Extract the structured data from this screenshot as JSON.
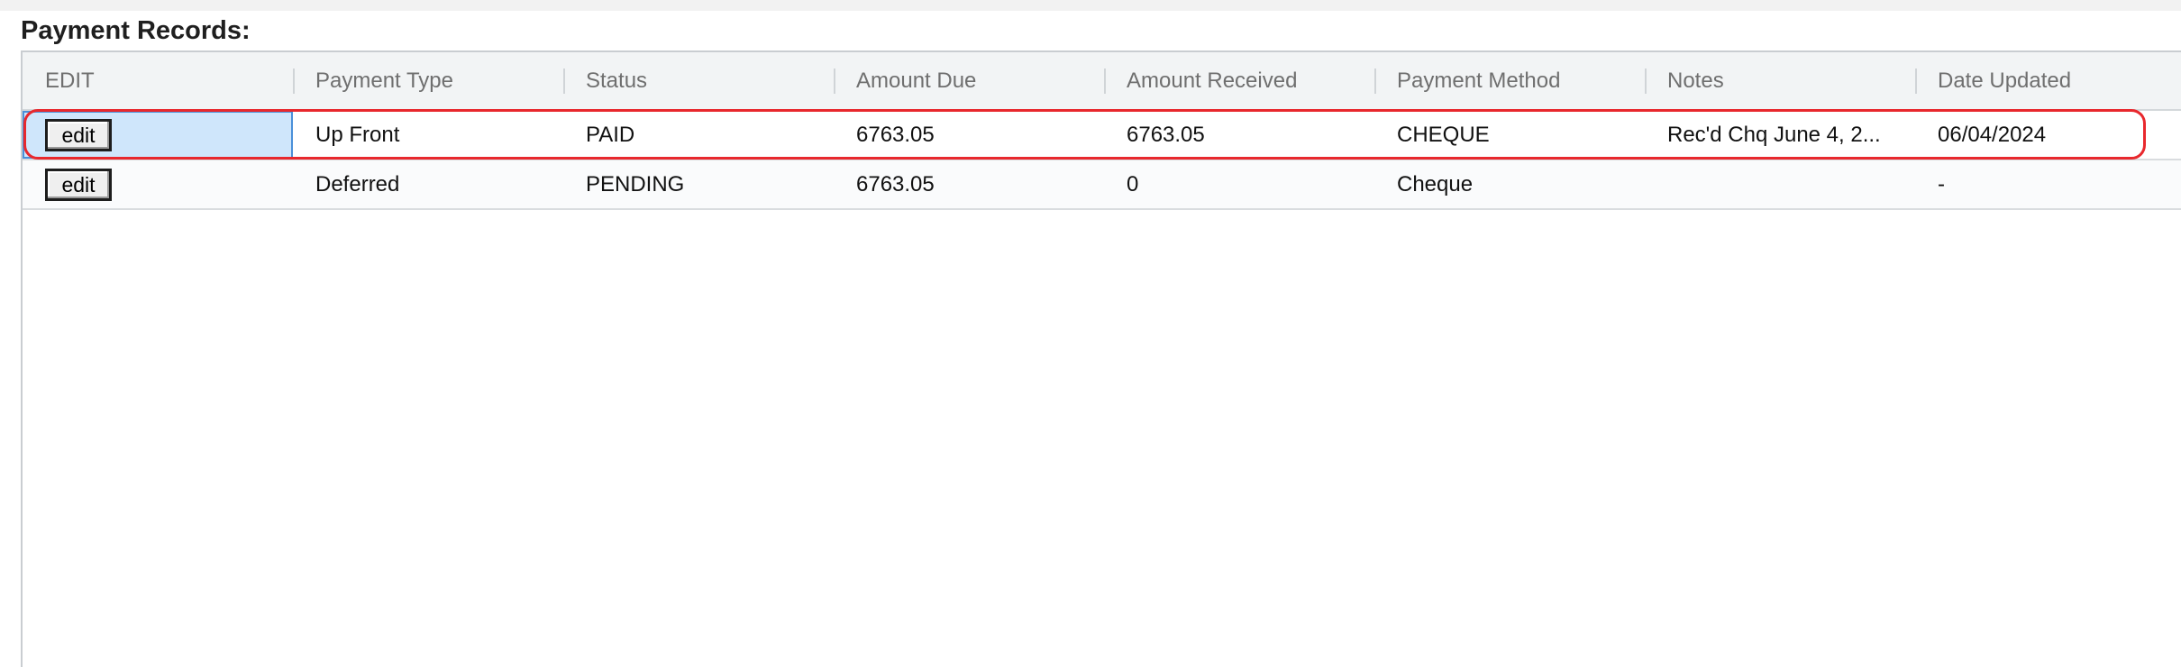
{
  "section": {
    "title": "Payment Records:"
  },
  "table": {
    "columns": [
      "EDIT",
      "Payment Type",
      "Status",
      "Amount Due",
      "Amount Received",
      "Payment Method",
      "Notes",
      "Date Updated"
    ],
    "rows": [
      {
        "edit_label": "edit",
        "payment_type": "Up Front",
        "status": "PAID",
        "amount_due": "6763.05",
        "amount_received": "6763.05",
        "payment_method": "CHEQUE",
        "notes": "Rec'd Chq June 4, 2...",
        "date_updated": "06/04/2024",
        "selected": true,
        "highlighted": true
      },
      {
        "edit_label": "edit",
        "payment_type": "Deferred",
        "status": "PENDING",
        "amount_due": "6763.05",
        "amount_received": "0",
        "payment_method": "Cheque",
        "notes": "",
        "date_updated": "-",
        "selected": false,
        "highlighted": false
      }
    ]
  },
  "colors": {
    "highlight": "#e8282d",
    "selection": "#cfe6fb",
    "header_bg": "#f2f4f5"
  }
}
